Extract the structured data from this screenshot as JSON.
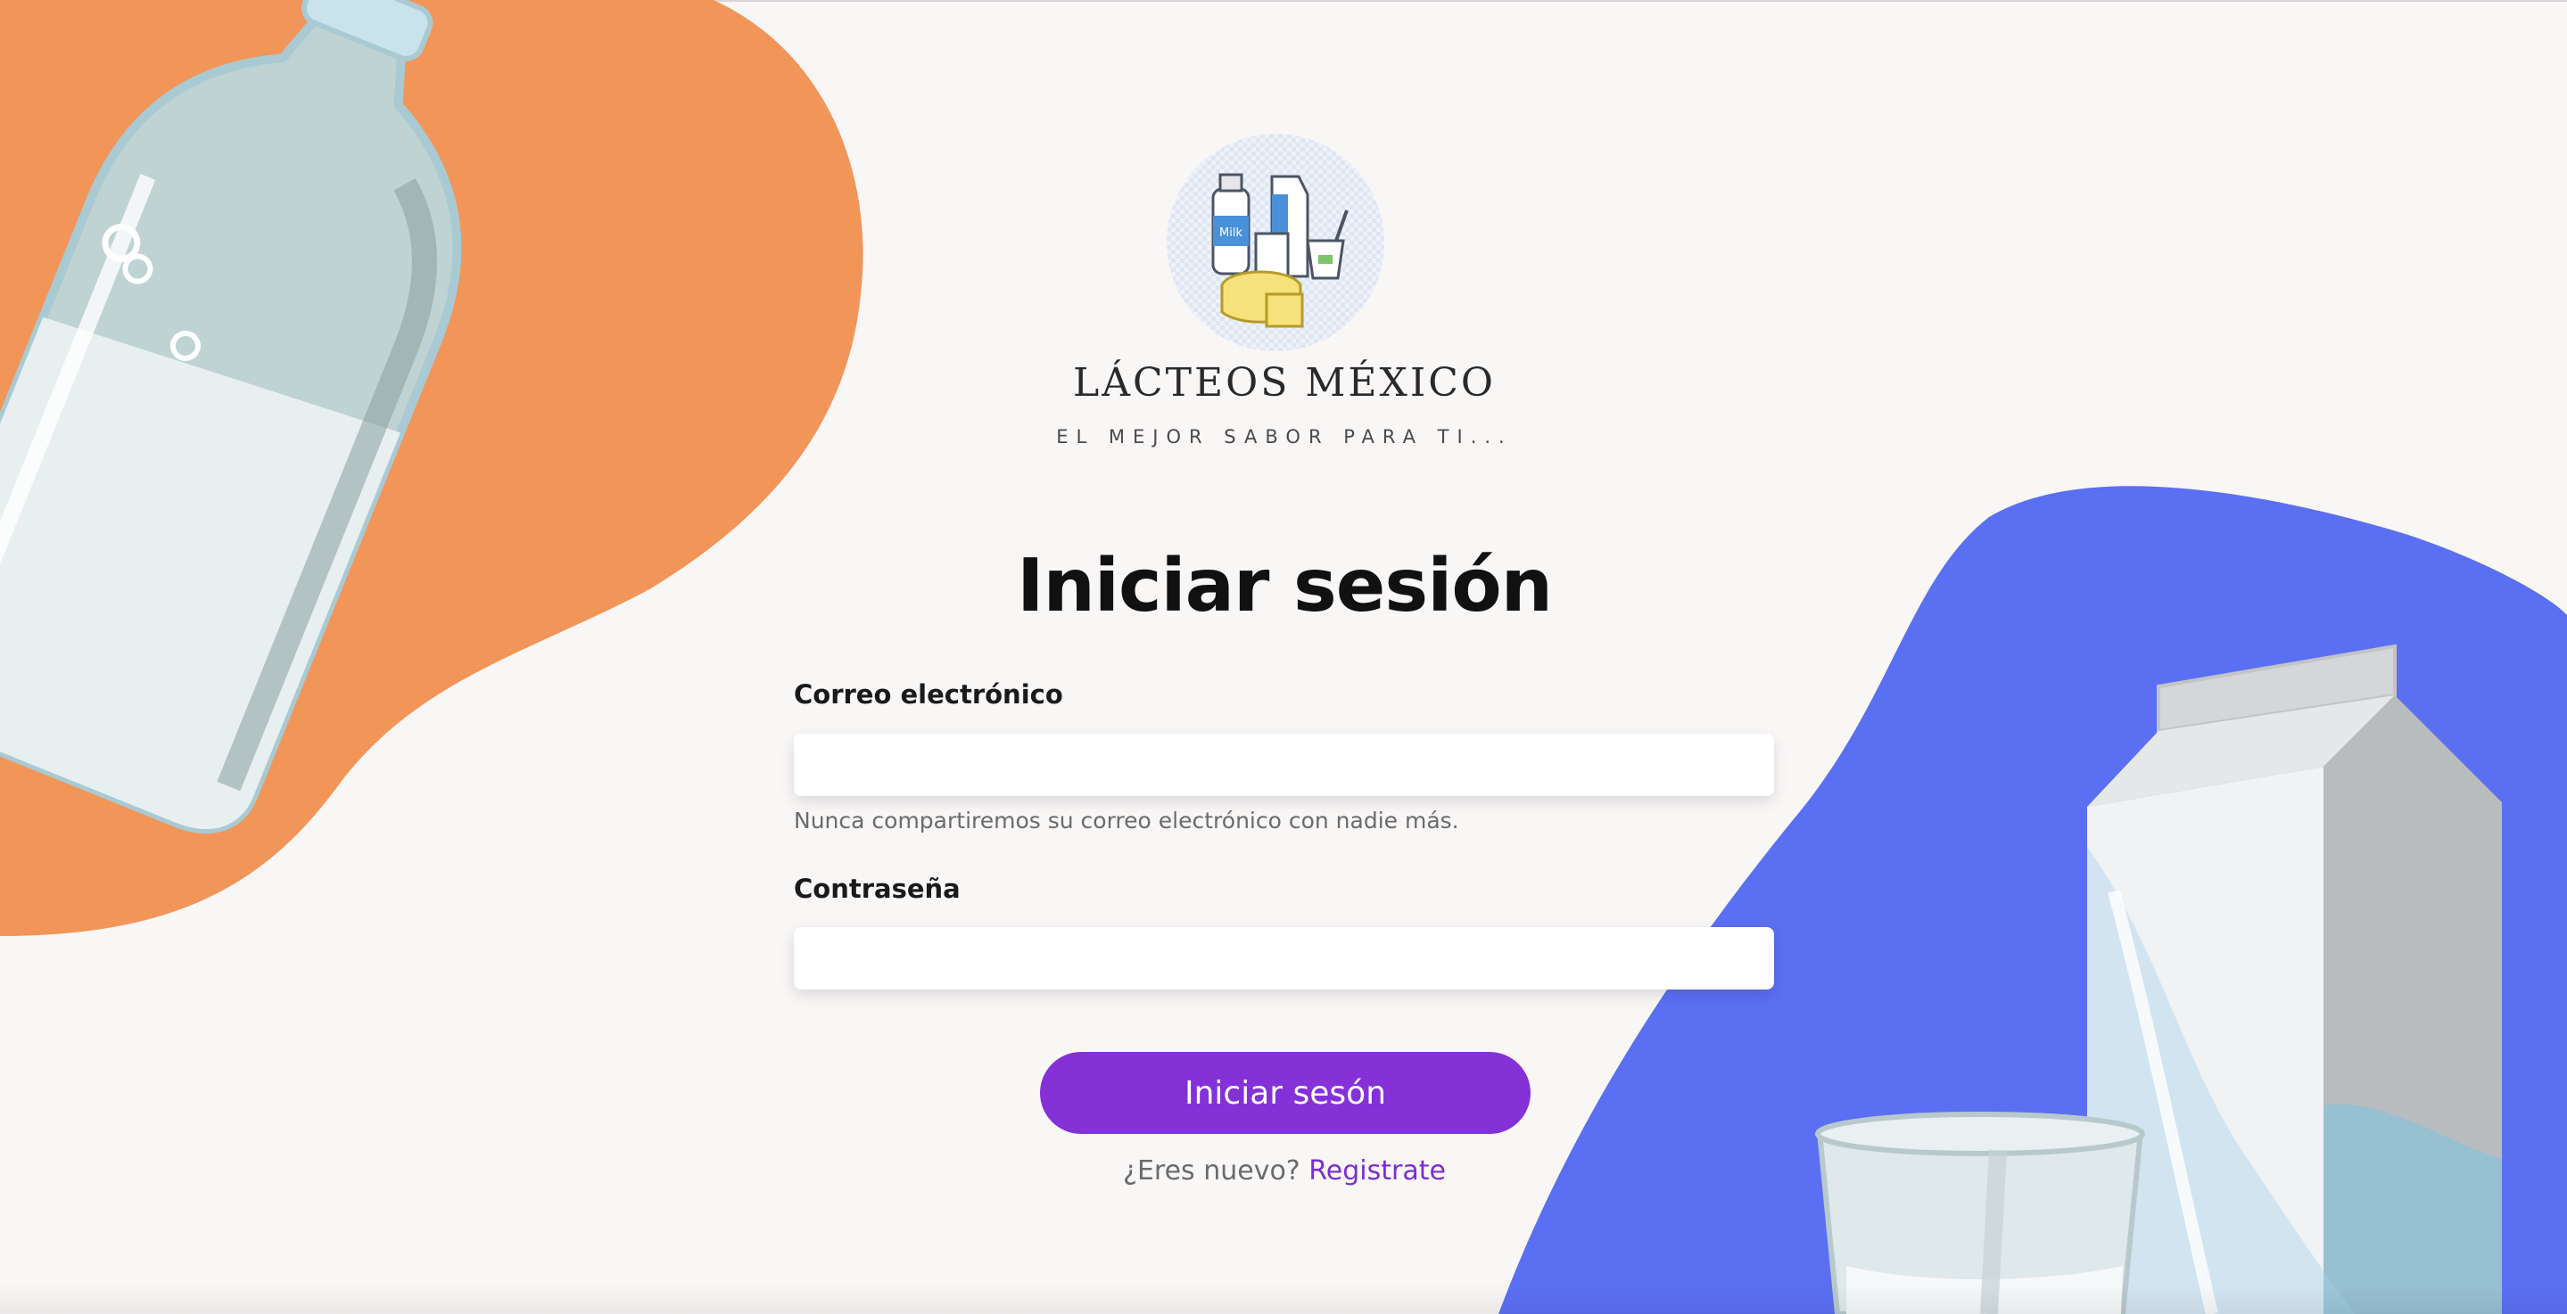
{
  "brand": {
    "name": "LÁCTEOS MÉXICO",
    "tagline": "EL MEJOR SABOR PARA TI...",
    "logo_label": "Milk"
  },
  "login": {
    "heading": "Iniciar sesión",
    "email_label": "Correo electrónico",
    "email_value": "",
    "email_help": "Nunca compartiremos su correo electrónico con nadie más.",
    "password_label": "Contraseña",
    "password_value": "",
    "submit_label": "Iniciar sesón",
    "register_prompt": "¿Eres nuevo?",
    "register_link": "Registrate"
  },
  "colors": {
    "background": "#f9f6f6",
    "orange_blob": "#f29559",
    "blue_blob": "#5b6ff3",
    "accent": "#8431d8"
  },
  "icons": {
    "logo": "dairy-products-icon",
    "bottle": "milk-bottle-illustration",
    "carton": "milk-carton-illustration",
    "glass": "milk-glass-illustration"
  }
}
